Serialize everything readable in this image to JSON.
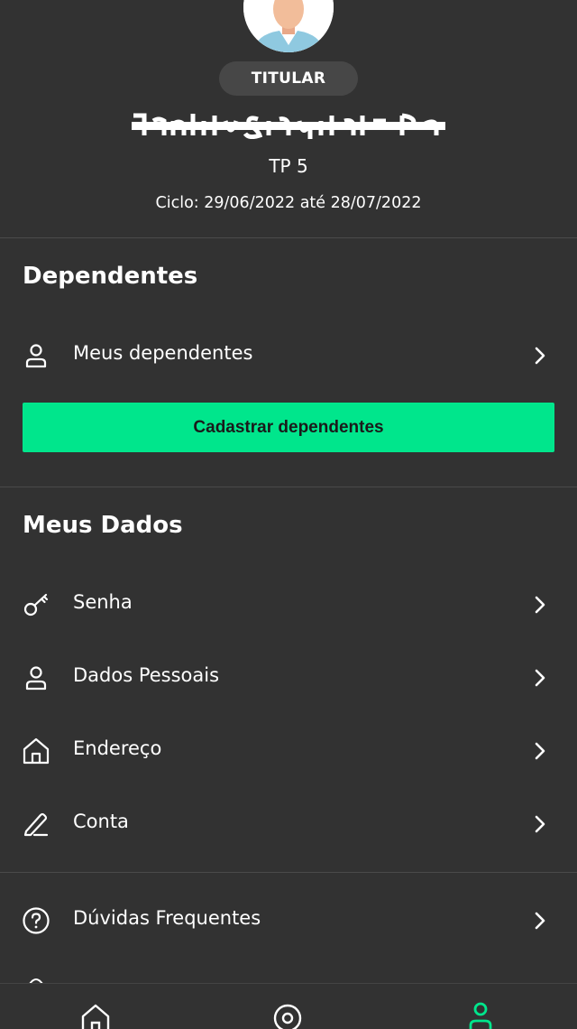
{
  "profile": {
    "badge_label": "TITULAR",
    "plan": "TP 5",
    "cycle": "Ciclo: 29/06/2022 até 28/07/2022"
  },
  "dependentes": {
    "title": "Dependentes",
    "items": [
      {
        "label": "Meus dependentes",
        "icon": "user-icon"
      }
    ],
    "register_button": "Cadastrar dependentes"
  },
  "meus_dados": {
    "title": "Meus Dados",
    "items": [
      {
        "label": "Senha",
        "icon": "key-icon"
      },
      {
        "label": "Dados Pessoais",
        "icon": "user-icon"
      },
      {
        "label": "Endereço",
        "icon": "home-icon"
      },
      {
        "label": "Conta",
        "icon": "pencil-icon"
      }
    ]
  },
  "help": {
    "items": [
      {
        "label": "Dúvidas Frequentes",
        "icon": "help-circle-icon"
      }
    ]
  },
  "tabbar": {
    "tabs": [
      {
        "icon": "home-icon",
        "active": false
      },
      {
        "icon": "target-icon",
        "active": false
      },
      {
        "icon": "profile-icon",
        "active": true
      }
    ]
  },
  "colors": {
    "background": "#323232",
    "accent": "#00e68c",
    "badge": "#474747",
    "divider": "#4a4a4a"
  }
}
